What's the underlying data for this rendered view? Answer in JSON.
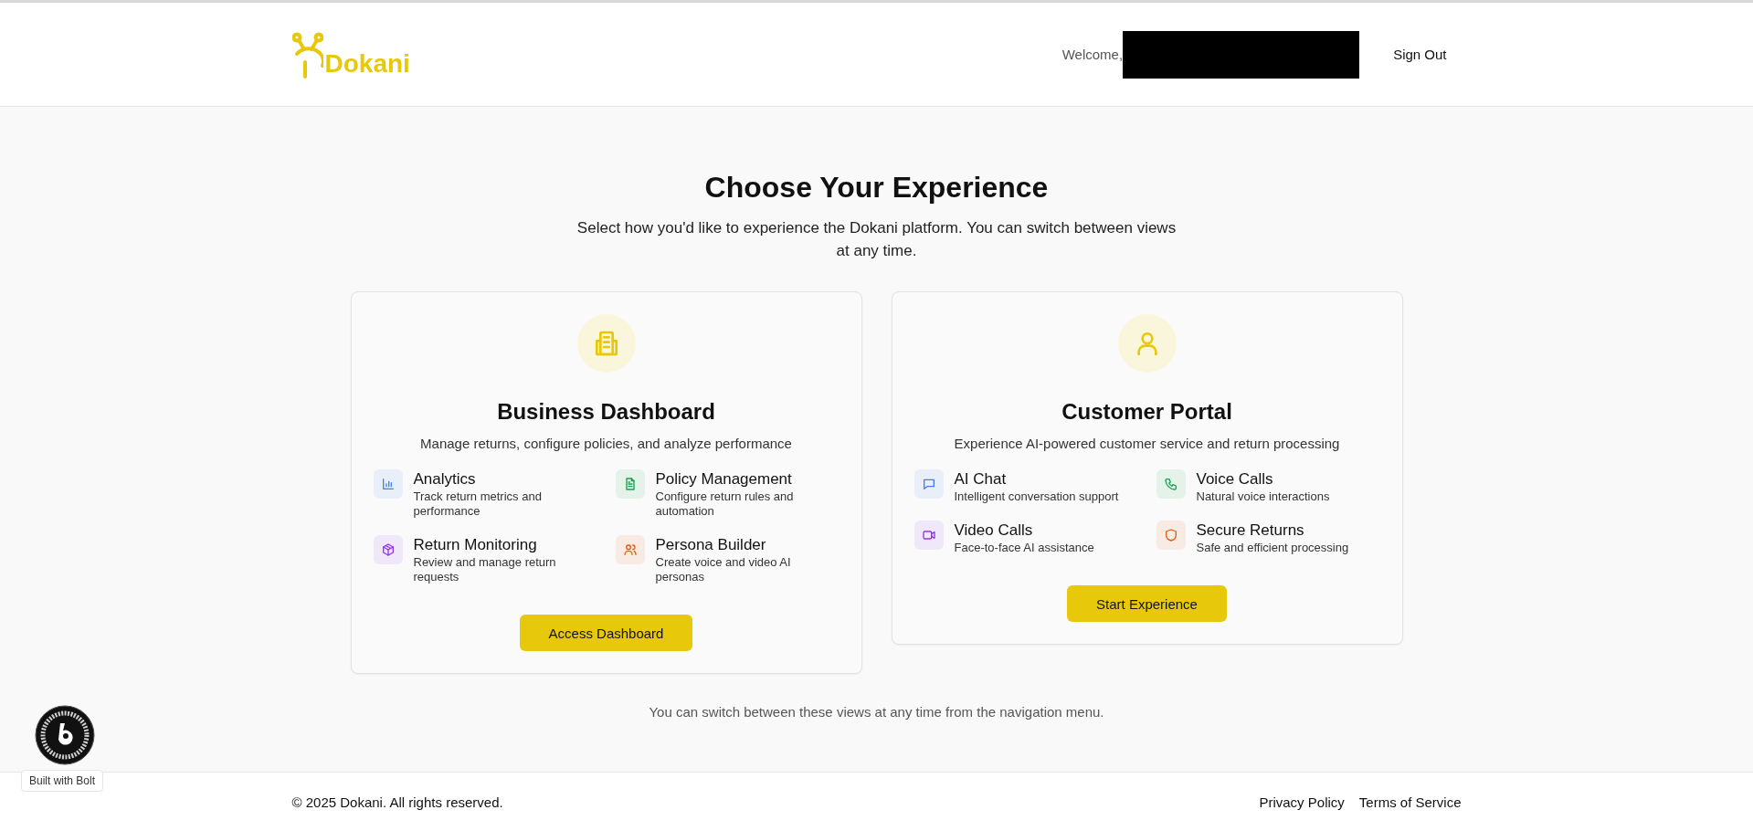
{
  "header": {
    "logo": "Dokani",
    "welcome": "Welcome,",
    "sign_out": "Sign Out"
  },
  "hero": {
    "title": "Choose Your Experience",
    "subtitle": "Select how you'd like to experience the Dokani platform. You can switch between views at any time."
  },
  "cards": [
    {
      "kind": "building",
      "title": "Business Dashboard",
      "description": "Manage returns, configure policies, and analyze performance",
      "button": "Access Dashboard",
      "features": [
        {
          "kind": "chart",
          "color": "#3b82f6",
          "title": "Analytics",
          "description": "Track return metrics and performance"
        },
        {
          "kind": "document",
          "color": "#16a34a",
          "title": "Policy Management",
          "description": "Configure return rules and automation"
        },
        {
          "kind": "box",
          "color": "#9333ea",
          "title": "Return Monitoring",
          "description": "Review and manage return requests"
        },
        {
          "kind": "users",
          "color": "#ea580c",
          "title": "Persona Builder",
          "description": "Create voice and video AI personas"
        }
      ]
    },
    {
      "kind": "user",
      "title": "Customer Portal",
      "description": "Experience AI-powered customer service and return processing",
      "button": "Start Experience",
      "features": [
        {
          "kind": "chat",
          "color": "#3b82f6",
          "title": "AI Chat",
          "description": "Intelligent conversation support"
        },
        {
          "kind": "phone",
          "color": "#16a34a",
          "title": "Voice Calls",
          "description": "Natural voice interactions"
        },
        {
          "kind": "video",
          "color": "#9333ea",
          "title": "Video Calls",
          "description": "Face-to-face AI assistance"
        },
        {
          "kind": "shield",
          "color": "#ea580c",
          "title": "Secure Returns",
          "description": "Safe and efficient processing"
        }
      ]
    }
  ],
  "note": "You can switch between these views at any time from the navigation menu.",
  "bolt_badge": {
    "label": "Built with Bolt"
  },
  "footer": {
    "copyright": "© 2025 Dokani. All rights reserved.",
    "links": [
      "Privacy Policy",
      "Terms of Service"
    ]
  }
}
